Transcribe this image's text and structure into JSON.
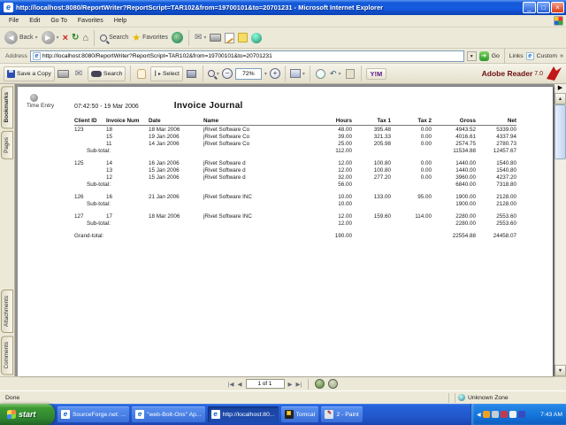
{
  "titlebar": {
    "title": "http://localhost:8080/ReportWriter?ReportScript=TAR102&from=19700101&to=20701231 - Microsoft Internet Explorer"
  },
  "menubar": {
    "items": [
      "File",
      "Edit",
      "Go To",
      "Favorites",
      "Help"
    ]
  },
  "ie_toolbar": {
    "back_label": "Back",
    "search_label": "Search",
    "favorites_label": "Favorites"
  },
  "addressbar": {
    "label": "Address",
    "url": "http://localhost:8080/ReportWriter?ReportScript=TAR102&from=19700101&to=20701231",
    "go_label": "Go",
    "links_label": "Links",
    "custom_label": "Custom"
  },
  "reader_toolbar": {
    "save_label": "Save a Copy",
    "search_label": "Search",
    "select_label": "Select",
    "zoom_value": "72%",
    "ym_label": "Y!M",
    "brand_name": "Adobe Reader",
    "brand_version": "7.0"
  },
  "sidebar": {
    "tabs": [
      "Bookmarks",
      "Pages",
      "Attachments",
      "Comments"
    ]
  },
  "report": {
    "logo_label": "Time Entry",
    "timestamp": "07:42:50 - 19 Mar 2006",
    "title": "Invoice Journal",
    "columns": [
      "Client ID",
      "Invoice Num",
      "Date",
      "Name",
      "Hours",
      "Tax 1",
      "Tax 2",
      "Gross",
      "Net"
    ],
    "subtotal_label": "Sub-total:",
    "grand_total_label": "Grand-total:",
    "groups": [
      {
        "client_id": "123",
        "rows": [
          {
            "invoice": "18",
            "date": "18 Mar 2006",
            "name": "jRivet Software Co",
            "hours": "48.00",
            "tax1": "395.48",
            "tax2": "0.00",
            "gross": "4943.52",
            "net": "5339.00"
          },
          {
            "invoice": "15",
            "date": "19 Jan 2006",
            "name": "jRivet Software Co",
            "hours": "39.00",
            "tax1": "321.33",
            "tax2": "0.00",
            "gross": "4016.61",
            "net": "4337.94"
          },
          {
            "invoice": "11",
            "date": "14 Jan 2006",
            "name": "jRivet Software Co",
            "hours": "25.00",
            "tax1": "205.98",
            "tax2": "0.00",
            "gross": "2574.75",
            "net": "2780.73"
          }
        ],
        "subtotal": {
          "hours": "112.00",
          "gross": "11534.88",
          "net": "12457.67"
        }
      },
      {
        "client_id": "125",
        "rows": [
          {
            "invoice": "14",
            "date": "16 Jan 2006",
            "name": "jRivet Software d",
            "hours": "12.00",
            "tax1": "100.80",
            "tax2": "0.00",
            "gross": "1440.00",
            "net": "1540.80"
          },
          {
            "invoice": "13",
            "date": "15 Jan 2006",
            "name": "jRivet Software d",
            "hours": "12.00",
            "tax1": "100.80",
            "tax2": "0.00",
            "gross": "1440.00",
            "net": "1540.80"
          },
          {
            "invoice": "12",
            "date": "15 Jan 2006",
            "name": "jRivet Software d",
            "hours": "32.00",
            "tax1": "277.20",
            "tax2": "0.00",
            "gross": "3960.00",
            "net": "4237.20"
          }
        ],
        "subtotal": {
          "hours": "56.00",
          "gross": "6840.00",
          "net": "7318.80"
        }
      },
      {
        "client_id": "126",
        "rows": [
          {
            "invoice": "16",
            "date": "21 Jan 2006",
            "name": "jRivet Software INC",
            "hours": "10.00",
            "tax1": "133.00",
            "tax2": "95.00",
            "gross": "1900.00",
            "net": "2128.00"
          }
        ],
        "subtotal": {
          "hours": "10.00",
          "gross": "1900.00",
          "net": "2128.00"
        }
      },
      {
        "client_id": "127",
        "rows": [
          {
            "invoice": "17",
            "date": "18 Mar 2006",
            "name": "jRivet Software INC",
            "hours": "12.00",
            "tax1": "159.60",
            "tax2": "114.00",
            "gross": "2280.00",
            "net": "2553.60"
          }
        ],
        "subtotal": {
          "hours": "12.00",
          "gross": "2280.00",
          "net": "2553.60"
        }
      }
    ],
    "grand_total": {
      "hours": "190.00",
      "gross": "22554.88",
      "net": "24458.07"
    }
  },
  "page_nav": {
    "page_label": "1 of 1"
  },
  "statusbar": {
    "left": "Done",
    "zone": "Unknown Zone"
  },
  "taskbar": {
    "start_label": "start",
    "items": [
      {
        "label": "SourceForge.net: ...",
        "icon": "ie",
        "active": false
      },
      {
        "label": "\"web-Bolt-Ons\" Ap...",
        "icon": "ie",
        "active": false
      },
      {
        "label": "http://localhost:80...",
        "icon": "ie",
        "active": true
      },
      {
        "label": "Tomcat",
        "icon": "tomcat",
        "active": false
      },
      {
        "label": "2 - Paint",
        "icon": "paint",
        "active": false
      }
    ],
    "time": "7:43 AM"
  }
}
